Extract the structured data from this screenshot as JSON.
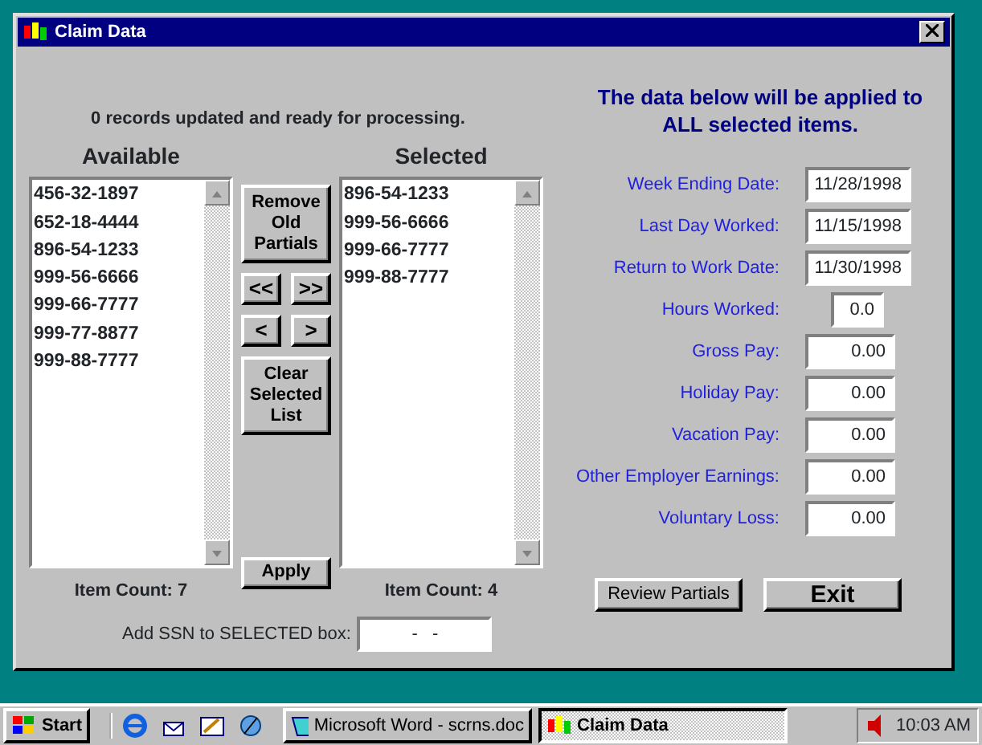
{
  "window": {
    "title": "Claim Data"
  },
  "status_message": "0 records updated and ready for processing.",
  "available": {
    "heading": "Available",
    "items": [
      "456-32-1897",
      "652-18-4444",
      "896-54-1233",
      "999-56-6666",
      "999-66-7777",
      "999-77-8877",
      "999-88-7777"
    ],
    "count": "Item Count: 7"
  },
  "selected": {
    "heading": "Selected",
    "items": [
      "896-54-1233",
      "999-56-6666",
      "999-66-7777",
      "999-88-7777"
    ],
    "count": "Item Count: 4"
  },
  "middle_buttons": [
    {
      "label": "Remove Old Partials",
      "kind": "wide"
    },
    {
      "label": "<<",
      "kind": "pair"
    },
    {
      "label": ">>",
      "kind": "pair"
    },
    {
      "label": "<",
      "kind": "pair"
    },
    {
      "label": ">",
      "kind": "pair"
    },
    {
      "label": "Clear Selected List",
      "kind": "wide"
    }
  ],
  "apply_button": "Apply",
  "add_ssn": {
    "label": "Add SSN to SELECTED box:",
    "value": "-   -"
  },
  "notice": "The data below will be applied to ALL selected items.",
  "fields": [
    {
      "label": "Week Ending Date:",
      "value": "11/28/1998",
      "kind": "date"
    },
    {
      "label": "Last Day Worked:",
      "value": "11/15/1998",
      "kind": "date"
    },
    {
      "label": "Return to Work Date:",
      "value": "11/30/1998",
      "kind": "date"
    },
    {
      "label": "Hours Worked:",
      "value": "0.0",
      "kind": "hours"
    },
    {
      "label": "Gross Pay:",
      "value": "0.00",
      "kind": "money"
    },
    {
      "label": "Holiday Pay:",
      "value": "0.00",
      "kind": "money"
    },
    {
      "label": "Vacation Pay:",
      "value": "0.00",
      "kind": "money"
    },
    {
      "label": "Other Employer Earnings:",
      "value": "0.00",
      "kind": "money"
    },
    {
      "label": "Voluntary Loss:",
      "value": "0.00",
      "kind": "money"
    }
  ],
  "footer_buttons": [
    {
      "label": "Review Partials",
      "kind": "normal"
    },
    {
      "label": "Exit",
      "kind": "large"
    }
  ],
  "taskbar": {
    "start": "Start",
    "tasks": [
      {
        "label": "Microsoft Word - scrns.doc",
        "selected": false
      },
      {
        "label": "Claim Data",
        "selected": true
      }
    ],
    "clock": "10:03 AM"
  }
}
